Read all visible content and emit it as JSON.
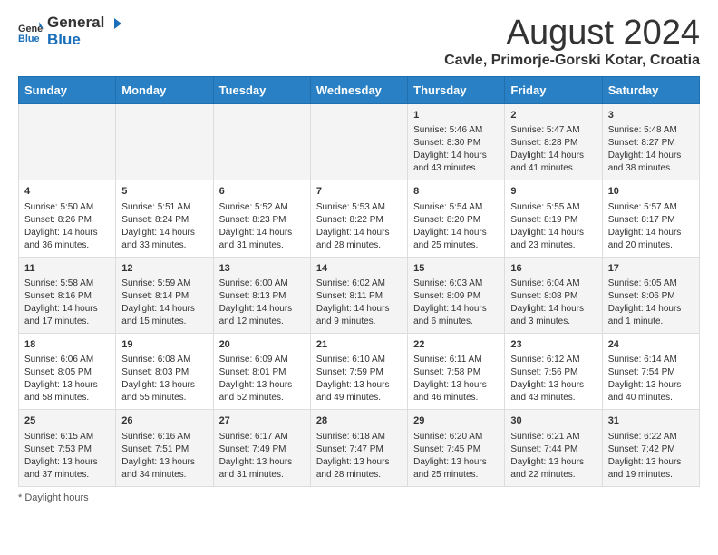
{
  "header": {
    "logo_general": "General",
    "logo_blue": "Blue",
    "month_year": "August 2024",
    "location": "Cavle, Primorje-Gorski Kotar, Croatia"
  },
  "days_of_week": [
    "Sunday",
    "Monday",
    "Tuesday",
    "Wednesday",
    "Thursday",
    "Friday",
    "Saturday"
  ],
  "weeks": [
    [
      {
        "day": "",
        "detail": ""
      },
      {
        "day": "",
        "detail": ""
      },
      {
        "day": "",
        "detail": ""
      },
      {
        "day": "",
        "detail": ""
      },
      {
        "day": "1",
        "detail": "Sunrise: 5:46 AM\nSunset: 8:30 PM\nDaylight: 14 hours and 43 minutes."
      },
      {
        "day": "2",
        "detail": "Sunrise: 5:47 AM\nSunset: 8:28 PM\nDaylight: 14 hours and 41 minutes."
      },
      {
        "day": "3",
        "detail": "Sunrise: 5:48 AM\nSunset: 8:27 PM\nDaylight: 14 hours and 38 minutes."
      }
    ],
    [
      {
        "day": "4",
        "detail": "Sunrise: 5:50 AM\nSunset: 8:26 PM\nDaylight: 14 hours and 36 minutes."
      },
      {
        "day": "5",
        "detail": "Sunrise: 5:51 AM\nSunset: 8:24 PM\nDaylight: 14 hours and 33 minutes."
      },
      {
        "day": "6",
        "detail": "Sunrise: 5:52 AM\nSunset: 8:23 PM\nDaylight: 14 hours and 31 minutes."
      },
      {
        "day": "7",
        "detail": "Sunrise: 5:53 AM\nSunset: 8:22 PM\nDaylight: 14 hours and 28 minutes."
      },
      {
        "day": "8",
        "detail": "Sunrise: 5:54 AM\nSunset: 8:20 PM\nDaylight: 14 hours and 25 minutes."
      },
      {
        "day": "9",
        "detail": "Sunrise: 5:55 AM\nSunset: 8:19 PM\nDaylight: 14 hours and 23 minutes."
      },
      {
        "day": "10",
        "detail": "Sunrise: 5:57 AM\nSunset: 8:17 PM\nDaylight: 14 hours and 20 minutes."
      }
    ],
    [
      {
        "day": "11",
        "detail": "Sunrise: 5:58 AM\nSunset: 8:16 PM\nDaylight: 14 hours and 17 minutes."
      },
      {
        "day": "12",
        "detail": "Sunrise: 5:59 AM\nSunset: 8:14 PM\nDaylight: 14 hours and 15 minutes."
      },
      {
        "day": "13",
        "detail": "Sunrise: 6:00 AM\nSunset: 8:13 PM\nDaylight: 14 hours and 12 minutes."
      },
      {
        "day": "14",
        "detail": "Sunrise: 6:02 AM\nSunset: 8:11 PM\nDaylight: 14 hours and 9 minutes."
      },
      {
        "day": "15",
        "detail": "Sunrise: 6:03 AM\nSunset: 8:09 PM\nDaylight: 14 hours and 6 minutes."
      },
      {
        "day": "16",
        "detail": "Sunrise: 6:04 AM\nSunset: 8:08 PM\nDaylight: 14 hours and 3 minutes."
      },
      {
        "day": "17",
        "detail": "Sunrise: 6:05 AM\nSunset: 8:06 PM\nDaylight: 14 hours and 1 minute."
      }
    ],
    [
      {
        "day": "18",
        "detail": "Sunrise: 6:06 AM\nSunset: 8:05 PM\nDaylight: 13 hours and 58 minutes."
      },
      {
        "day": "19",
        "detail": "Sunrise: 6:08 AM\nSunset: 8:03 PM\nDaylight: 13 hours and 55 minutes."
      },
      {
        "day": "20",
        "detail": "Sunrise: 6:09 AM\nSunset: 8:01 PM\nDaylight: 13 hours and 52 minutes."
      },
      {
        "day": "21",
        "detail": "Sunrise: 6:10 AM\nSunset: 7:59 PM\nDaylight: 13 hours and 49 minutes."
      },
      {
        "day": "22",
        "detail": "Sunrise: 6:11 AM\nSunset: 7:58 PM\nDaylight: 13 hours and 46 minutes."
      },
      {
        "day": "23",
        "detail": "Sunrise: 6:12 AM\nSunset: 7:56 PM\nDaylight: 13 hours and 43 minutes."
      },
      {
        "day": "24",
        "detail": "Sunrise: 6:14 AM\nSunset: 7:54 PM\nDaylight: 13 hours and 40 minutes."
      }
    ],
    [
      {
        "day": "25",
        "detail": "Sunrise: 6:15 AM\nSunset: 7:53 PM\nDaylight: 13 hours and 37 minutes."
      },
      {
        "day": "26",
        "detail": "Sunrise: 6:16 AM\nSunset: 7:51 PM\nDaylight: 13 hours and 34 minutes."
      },
      {
        "day": "27",
        "detail": "Sunrise: 6:17 AM\nSunset: 7:49 PM\nDaylight: 13 hours and 31 minutes."
      },
      {
        "day": "28",
        "detail": "Sunrise: 6:18 AM\nSunset: 7:47 PM\nDaylight: 13 hours and 28 minutes."
      },
      {
        "day": "29",
        "detail": "Sunrise: 6:20 AM\nSunset: 7:45 PM\nDaylight: 13 hours and 25 minutes."
      },
      {
        "day": "30",
        "detail": "Sunrise: 6:21 AM\nSunset: 7:44 PM\nDaylight: 13 hours and 22 minutes."
      },
      {
        "day": "31",
        "detail": "Sunrise: 6:22 AM\nSunset: 7:42 PM\nDaylight: 13 hours and 19 minutes."
      }
    ]
  ],
  "footer": {
    "note": "Daylight hours"
  }
}
